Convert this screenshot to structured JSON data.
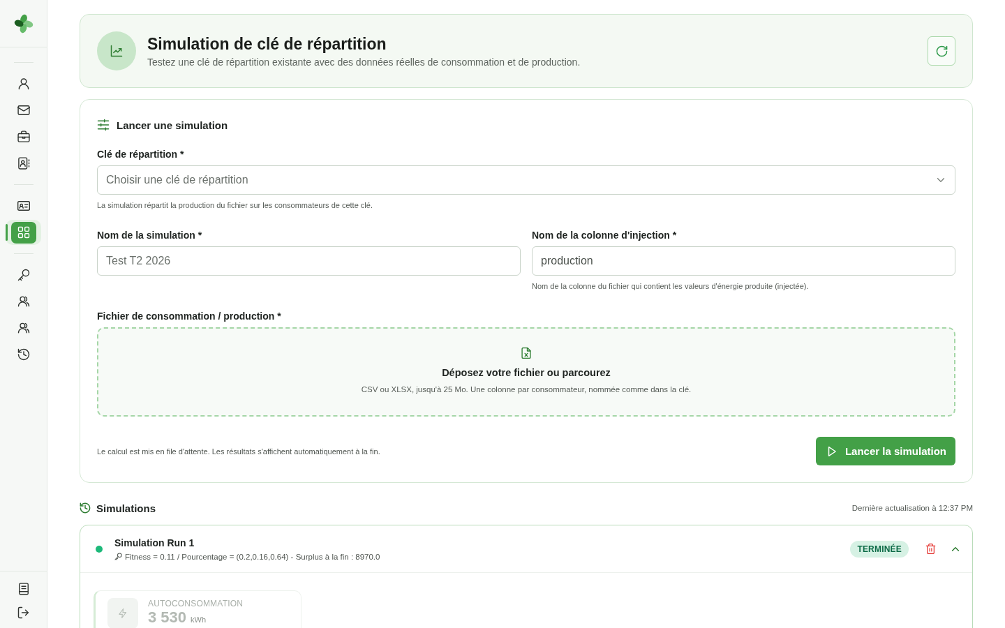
{
  "sidebar": {
    "sections": [
      {
        "items": [
          {
            "selected": false
          },
          {
            "selected": false
          },
          {
            "selected": false
          },
          {
            "selected": false
          }
        ]
      },
      {
        "items": [
          {
            "selected": false
          },
          {
            "selected": true
          }
        ]
      },
      {
        "items": [
          {
            "selected": false
          },
          {
            "selected": false
          },
          {
            "selected": false
          },
          {
            "selected": false
          }
        ]
      }
    ]
  },
  "header": {
    "title": "Simulation de clé de répartition",
    "subtitle": "Testez une clé de répartition existante avec des données réelles de consommation et de production."
  },
  "form": {
    "title": "Lancer une simulation",
    "key_field": {
      "label": "Clé de répartition *",
      "placeholder": "Choisir une clé de répartition",
      "help": "La simulation répartit la production du fichier sur les consommateurs de cette clé."
    },
    "name_field": {
      "label": "Nom de la simulation *",
      "placeholder": "Test T2 2026"
    },
    "column_field": {
      "label": "Nom de la colonne d'injection *",
      "value": "production",
      "help": "Nom de la colonne du fichier qui contient les valeurs d'énergie produite (injectée)."
    },
    "file_field": {
      "label": "Fichier de consommation / production *",
      "title": "Déposez votre fichier ou parcourez",
      "help": "CSV ou XLSX, jusqu'à 25 Mo. Une colonne par consommateur, nommée comme dans la clé."
    },
    "note": "Le calcul est mis en file d'attente. Les résultats s'affichent automatiquement à la fin.",
    "submit_button": "Lancer la simulation"
  },
  "simulations": {
    "title": "Simulations",
    "updated": "Dernière actualisation à 12:37 PM",
    "runs": [
      {
        "name": "Simulation Run 1",
        "details": "Fitness = 0.11 / Pourcentage = (0.2,0.16,0.64) - Surplus à la fin : 8970.0",
        "status": "TERMINÉE",
        "color": "#1db97a",
        "expanded": true,
        "stats": [
          {
            "label": "AUTOCONSOMMATION",
            "value": "3 530",
            "unit": "kWh"
          }
        ]
      }
    ]
  }
}
